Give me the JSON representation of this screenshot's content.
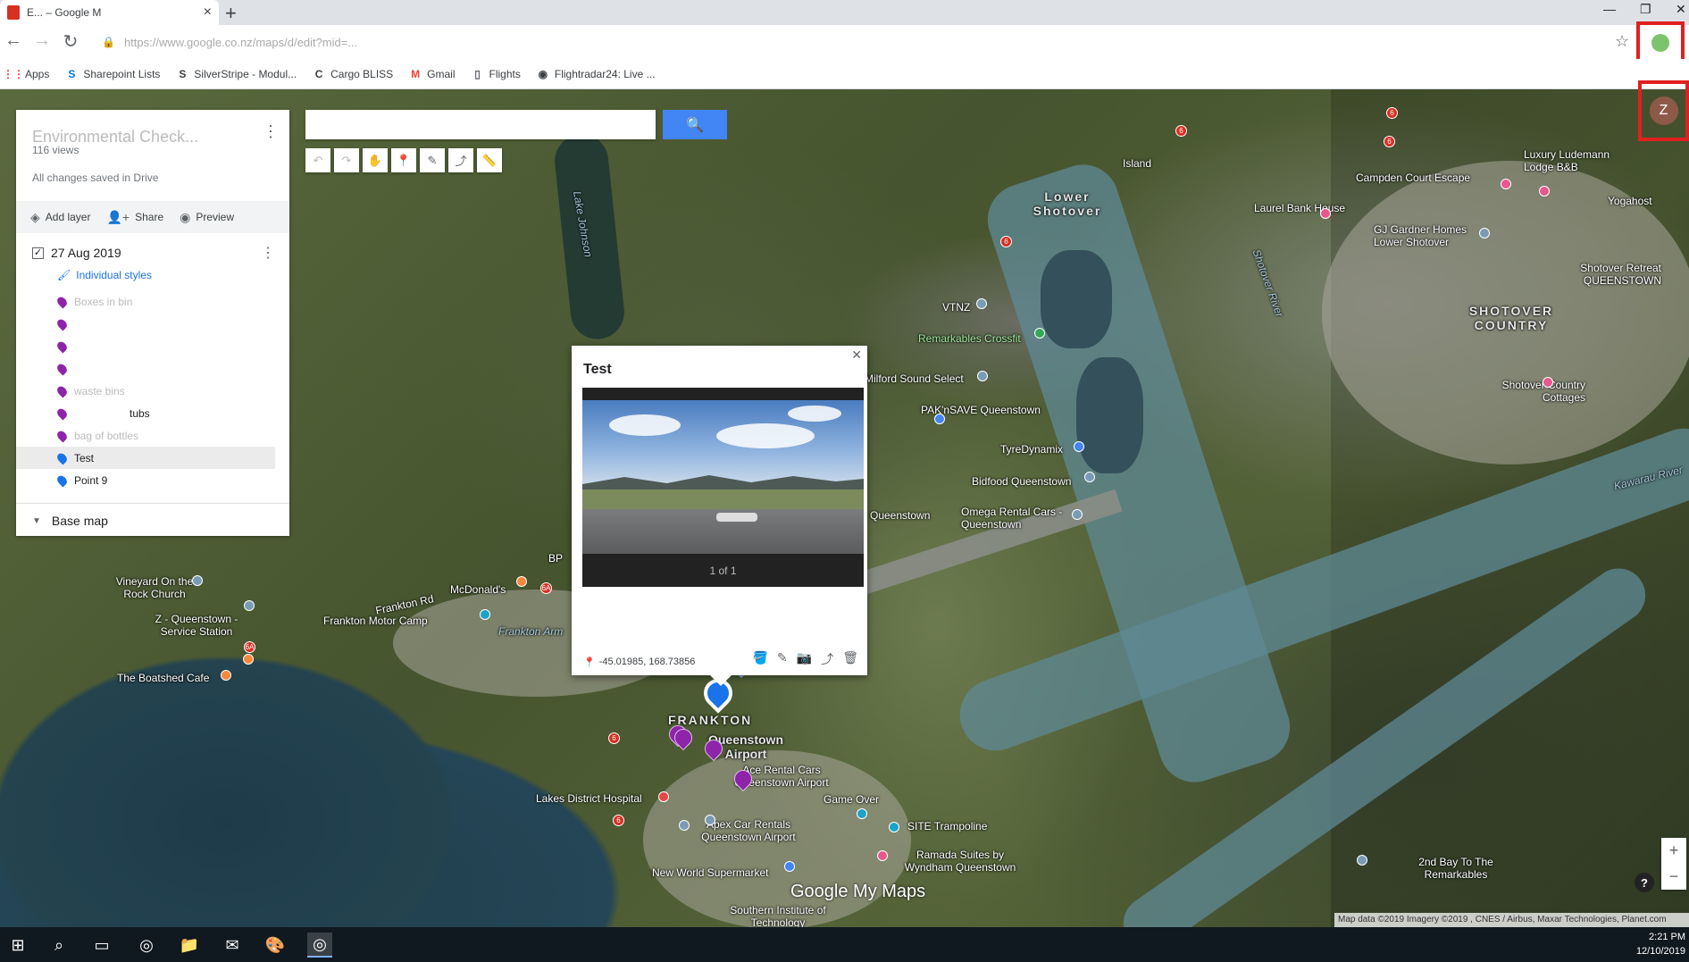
{
  "browser": {
    "tab_title": "E... – Google M",
    "new_tab_icon": "plus-icon",
    "url": "https://www.google.co.nz/maps/d/edit?mid=...",
    "bookmarks": [
      {
        "label": "Apps",
        "icon": "apps-grid-icon",
        "color": "#ea4335"
      },
      {
        "label": "Sharepoint Lists",
        "icon": "sharepoint-icon",
        "color": "#0078d4"
      },
      {
        "label": "SilverStripe - Modul...",
        "icon": "silverstripe-icon",
        "color": "#000000"
      },
      {
        "label": "Cargo BLISS",
        "icon": "cargo-icon",
        "color": "#000000"
      },
      {
        "label": "Gmail",
        "icon": "gmail-icon",
        "color": "#ea4335"
      },
      {
        "label": "Flights",
        "icon": "page-icon",
        "color": "#5f6368"
      },
      {
        "label": "Flightradar24: Live ...",
        "icon": "flightradar-icon",
        "color": "#000000"
      }
    ]
  },
  "panel": {
    "map_title": "Environmental Check...",
    "views": "116 views",
    "saved": "All changes saved in Drive",
    "actions": [
      {
        "label": "Add layer",
        "icon": "add-layer-icon"
      },
      {
        "label": "Share",
        "icon": "share-icon"
      },
      {
        "label": "Preview",
        "icon": "preview-icon"
      }
    ],
    "layer": {
      "name": "27 Aug 2019",
      "checked": true,
      "styles_label": "Individual styles",
      "items": [
        {
          "label": "Boxes in bin",
          "color": "purple",
          "faded": true
        },
        {
          "label": "",
          "color": "purple",
          "faded": true
        },
        {
          "label": "",
          "color": "purple",
          "faded": true
        },
        {
          "label": "",
          "color": "purple",
          "faded": true
        },
        {
          "label": "waste bins",
          "color": "purple",
          "faded": true
        },
        {
          "label": "tubs",
          "color": "purple",
          "faded": false
        },
        {
          "label": "bag of bottles",
          "color": "purple",
          "faded": true
        },
        {
          "label": "Test",
          "color": "blue",
          "faded": false,
          "active": true
        },
        {
          "label": "Point 9",
          "color": "blue",
          "faded": false
        }
      ]
    },
    "basemap": "Base map"
  },
  "search": {
    "placeholder": "",
    "value": ""
  },
  "info": {
    "title": "Test",
    "counter": "1 of 1",
    "coords": "-45.01985, 168.73856"
  },
  "map": {
    "labels": [
      {
        "text": "Island"
      },
      {
        "text": "Lower Shotover"
      },
      {
        "text": "Campden Court Escape"
      },
      {
        "text": "Luxury Ludemann Lodge B&B"
      },
      {
        "text": "Laurel Bank House"
      },
      {
        "text": "Yogahost"
      },
      {
        "text": "GJ Gardner Homes Lower Shotover"
      },
      {
        "text": "Shotover Retreat QUEENSTOWN"
      },
      {
        "text": "SHOTOVER COUNTRY"
      },
      {
        "text": "VTNZ"
      },
      {
        "text": "Remarkables Crossfit"
      },
      {
        "text": "Milford Sound Select"
      },
      {
        "text": "PAK'nSAVE Queenstown"
      },
      {
        "text": "TyreDynamix"
      },
      {
        "text": "Bidfood Queenstown"
      },
      {
        "text": "Omega Rental Cars - Queenstown"
      },
      {
        "text": "Shotover Country Cottages"
      },
      {
        "text": "Kawarau River"
      },
      {
        "text": "Shotover River"
      },
      {
        "text": "Lake Johnson"
      },
      {
        "text": "Vineyard On the Rock Church"
      },
      {
        "text": "Z - Queenstown - Service Station"
      },
      {
        "text": "McDonald's"
      },
      {
        "text": "Frankton Rd"
      },
      {
        "text": "Frankton Motor Camp"
      },
      {
        "text": "Frankton Arm"
      },
      {
        "text": "The Boatshed Cafe"
      },
      {
        "text": "FRANKTON"
      },
      {
        "text": "Queenstown Airport"
      },
      {
        "text": "Ace Rental Cars Queenstown Airport"
      },
      {
        "text": "Lakes District Hospital"
      },
      {
        "text": "Game Over"
      },
      {
        "text": "SITE Trampoline"
      },
      {
        "text": "Apex Car Rentals Queenstown Airport"
      },
      {
        "text": "Ramada Suites by Wyndham Queenstown"
      },
      {
        "text": "New World Supermarket"
      },
      {
        "text": "Southern Institute of Technology"
      },
      {
        "text": "2nd Bay To The Remarkables"
      },
      {
        "text": "BP"
      },
      {
        "text": "Queenstown"
      }
    ],
    "brand": "Google My Maps",
    "attribution": "Map data ©2019 Imagery ©2019 , CNES / Airbus, Maxar Technologies, Planet.com"
  },
  "avatar": {
    "letter": "Z"
  },
  "taskbar": {
    "time": "2:21 PM",
    "date": "12/10/2019"
  }
}
